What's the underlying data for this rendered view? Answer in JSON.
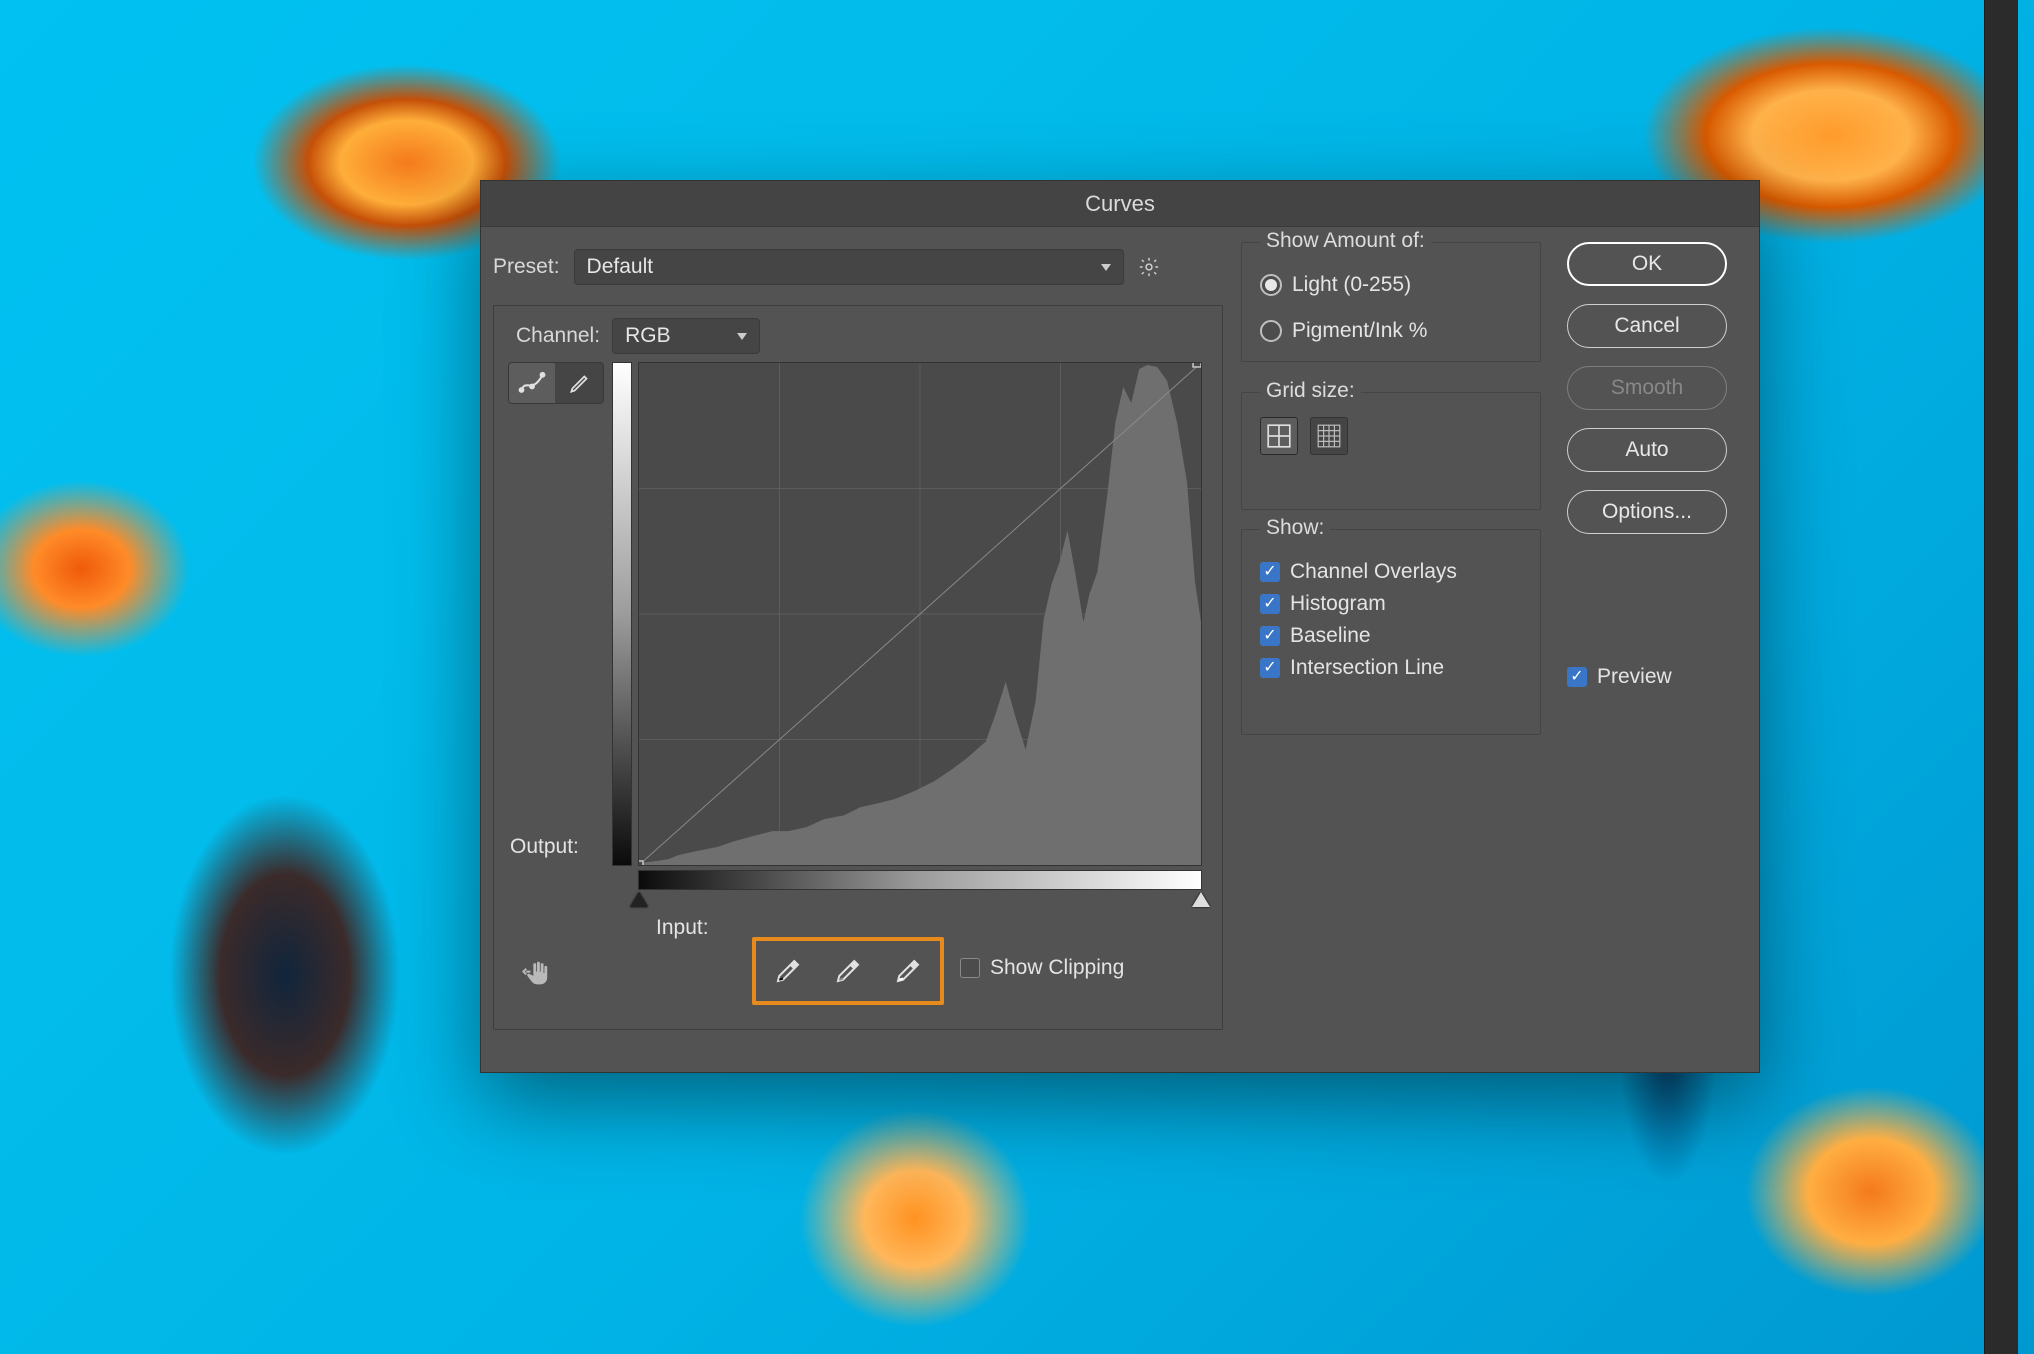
{
  "dialog": {
    "title": "Curves",
    "preset_label": "Preset:",
    "preset_value": "Default",
    "channel_label": "Channel:",
    "channel_value": "RGB",
    "output_label": "Output:",
    "input_label": "Input:",
    "show_clipping_label": "Show Clipping",
    "show_clipping_checked": false
  },
  "amount": {
    "legend": "Show Amount of:",
    "light_label": "Light  (0-255)",
    "pigment_label": "Pigment/Ink %",
    "selected": "light"
  },
  "display": {
    "legend": "Grid size:"
  },
  "show": {
    "legend": "Show:",
    "items": [
      {
        "label": "Channel Overlays",
        "checked": true
      },
      {
        "label": "Histogram",
        "checked": true
      },
      {
        "label": "Baseline",
        "checked": true
      },
      {
        "label": "Intersection Line",
        "checked": true
      }
    ]
  },
  "buttons": {
    "ok": "OK",
    "cancel": "Cancel",
    "smooth": "Smooth",
    "auto": "Auto",
    "options": "Options..."
  },
  "preview": {
    "label": "Preview",
    "checked": true
  },
  "icons": {
    "gear": "gear-icon",
    "curve_tool": "curve-tool-icon",
    "pencil_tool": "pencil-tool-icon",
    "hand": "targeted-adjustment-icon",
    "eyedrop_black": "eyedropper-black-point-icon",
    "eyedrop_gray": "eyedropper-gray-point-icon",
    "eyedrop_white": "eyedropper-white-point-icon",
    "grid_coarse": "grid-coarse-icon",
    "grid_fine": "grid-fine-icon"
  },
  "colors": {
    "highlight": "#e88b1d"
  }
}
